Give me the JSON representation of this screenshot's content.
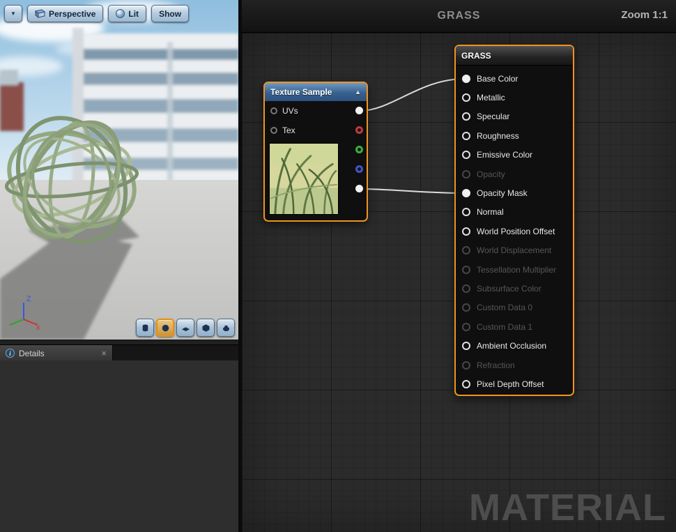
{
  "viewport": {
    "toolbar": {
      "dropdown_icon": "▼",
      "perspective_label": "Perspective",
      "lit_label": "Lit",
      "show_label": "Show"
    },
    "axis_gizmo": {
      "z_label": "Z",
      "x_label": "x"
    },
    "shape_buttons": [
      {
        "name": "cylinder",
        "active": false
      },
      {
        "name": "sphere",
        "active": true
      },
      {
        "name": "plane",
        "active": false
      },
      {
        "name": "cube",
        "active": false
      },
      {
        "name": "preview-mesh",
        "active": false
      }
    ]
  },
  "details": {
    "tab_label": "Details",
    "close_label": "×"
  },
  "graph": {
    "header_title": "GRASS",
    "zoom_label": "Zoom 1:1",
    "watermark": "MATERIAL",
    "texture_node": {
      "title": "Texture Sample",
      "collapse_icon": "▲",
      "inputs": [
        {
          "label": "UVs"
        },
        {
          "label": "Tex"
        }
      ],
      "outputs": [
        {
          "name": "rgb",
          "color": "#f2f2f2",
          "filled": true
        },
        {
          "name": "r",
          "color": "#c03a3a",
          "filled": false
        },
        {
          "name": "g",
          "color": "#3ab03a",
          "filled": false
        },
        {
          "name": "b",
          "color": "#4553c6",
          "filled": false
        },
        {
          "name": "a",
          "color": "#f2f2f2",
          "filled": true
        }
      ]
    },
    "material_node": {
      "title": "GRASS",
      "pins": [
        {
          "label": "Base Color",
          "enabled": true,
          "connected": true
        },
        {
          "label": "Metallic",
          "enabled": true,
          "connected": false
        },
        {
          "label": "Specular",
          "enabled": true,
          "connected": false
        },
        {
          "label": "Roughness",
          "enabled": true,
          "connected": false
        },
        {
          "label": "Emissive Color",
          "enabled": true,
          "connected": false
        },
        {
          "label": "Opacity",
          "enabled": false,
          "connected": false
        },
        {
          "label": "Opacity Mask",
          "enabled": true,
          "connected": true
        },
        {
          "label": "Normal",
          "enabled": true,
          "connected": false
        },
        {
          "label": "World Position Offset",
          "enabled": true,
          "connected": false
        },
        {
          "label": "World Displacement",
          "enabled": false,
          "connected": false
        },
        {
          "label": "Tessellation Multiplier",
          "enabled": false,
          "connected": false
        },
        {
          "label": "Subsurface Color",
          "enabled": false,
          "connected": false
        },
        {
          "label": "Custom Data 0",
          "enabled": false,
          "connected": false
        },
        {
          "label": "Custom Data 1",
          "enabled": false,
          "connected": false
        },
        {
          "label": "Ambient Occlusion",
          "enabled": true,
          "connected": false
        },
        {
          "label": "Refraction",
          "enabled": false,
          "connected": false
        },
        {
          "label": "Pixel Depth Offset",
          "enabled": true,
          "connected": false
        }
      ]
    }
  },
  "colors": {
    "selection_orange": "#f0941e",
    "wire": "#dcdcdc"
  }
}
